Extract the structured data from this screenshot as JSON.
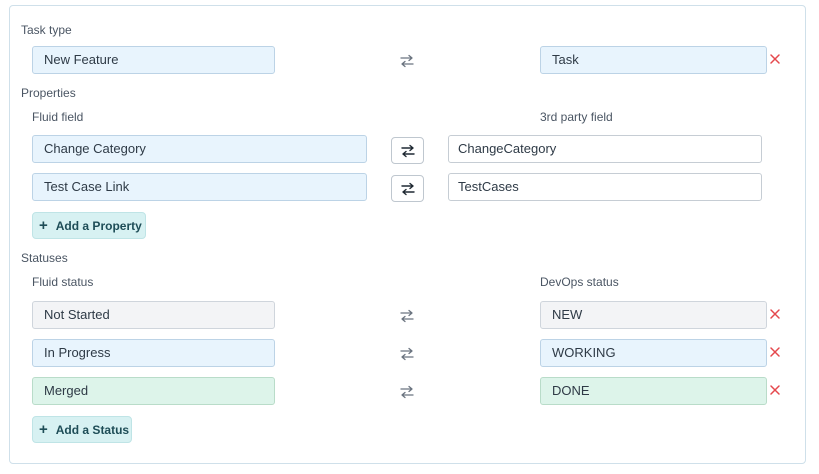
{
  "task_type": {
    "section_label": "Task type",
    "fluid_value": "New Feature",
    "third_party_value": "Task"
  },
  "properties": {
    "section_label": "Properties",
    "fluid_column_label": "Fluid field",
    "third_party_column_label": "3rd party field",
    "rows": [
      {
        "fluid": "Change Category",
        "third_party": "ChangeCategory"
      },
      {
        "fluid": "Test Case Link",
        "third_party": "TestCases"
      }
    ],
    "add_label": "Add a Property"
  },
  "statuses": {
    "section_label": "Statuses",
    "fluid_column_label": "Fluid status",
    "third_party_column_label": "DevOps status",
    "rows": [
      {
        "fluid": "Not Started",
        "third_party": "NEW",
        "color": "#f3f4f6"
      },
      {
        "fluid": "In Progress",
        "third_party": "WORKING",
        "color": "#e8f4fd"
      },
      {
        "fluid": "Merged",
        "third_party": "DONE",
        "color": "#ddf4ea"
      }
    ],
    "add_label": "Add a Status"
  },
  "colors": {
    "remove_icon": "#e5484d",
    "accent_button": "#d7f1f2"
  },
  "icons": {
    "swap": "swap-arrows-icon",
    "remove": "close-icon",
    "add": "plus-icon"
  }
}
